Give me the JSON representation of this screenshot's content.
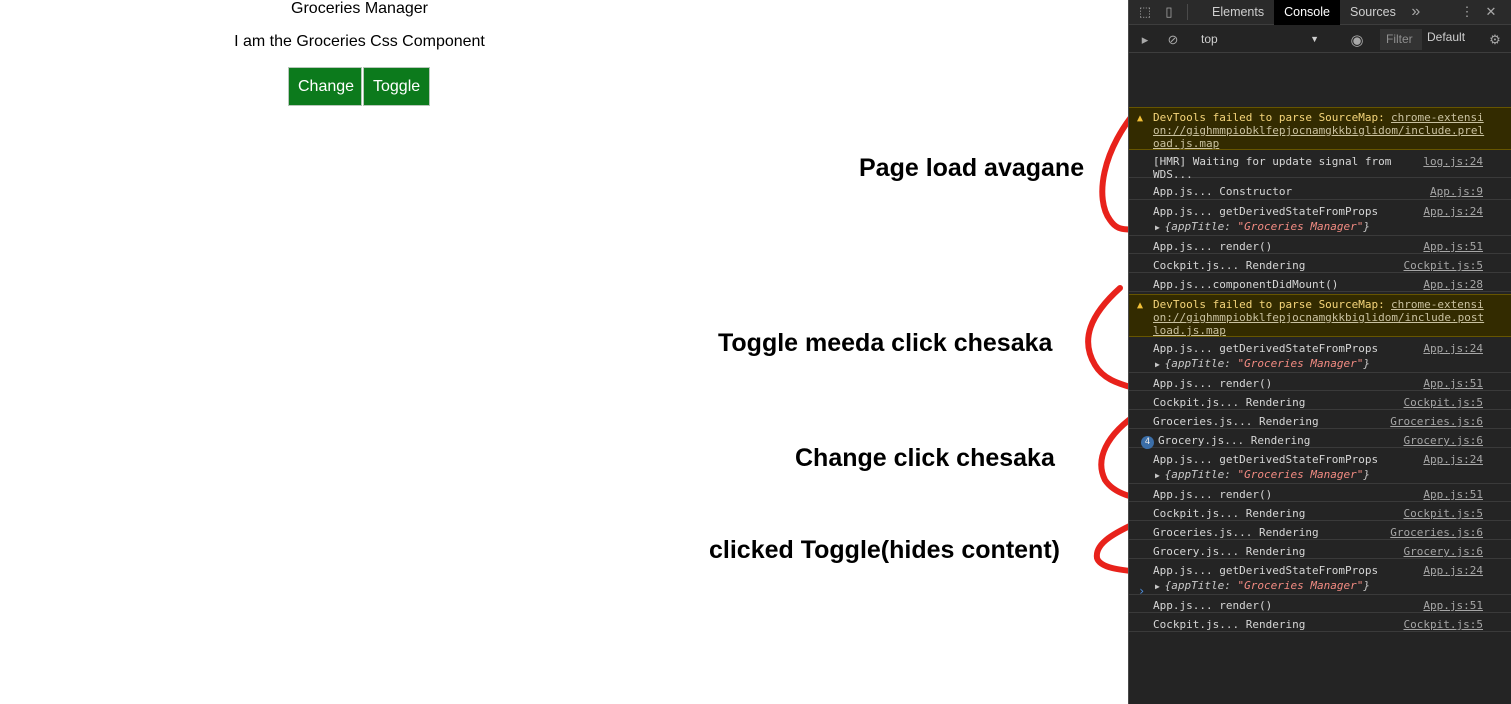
{
  "app": {
    "title": "Groceries Manager",
    "subtitle": "I am the Groceries Css Component",
    "buttons": {
      "change": "Change",
      "toggle": "Toggle"
    },
    "button_color": "#0c7a1c"
  },
  "annotations": {
    "page_load": "Page load avagane",
    "toggle_click": "Toggle meeda click chesaka",
    "change_click": "Change click chesaka",
    "clicked_toggle": "clicked Toggle(hides content)",
    "arc_color": "#e8221b"
  },
  "devtools": {
    "tabs": [
      "Elements",
      "Console",
      "Sources"
    ],
    "more_tabs": "»",
    "context": "top",
    "filter_placeholder": "Filter",
    "levels": "Default",
    "console": [
      {
        "type": "warn",
        "text": "DevTools failed to parse SourceMap: ",
        "link": "chrome-extensi\non://gighmmpiobklfepjocnamgkkbiglidom/include.prel\noad.js.map"
      },
      {
        "type": "log",
        "text": "[HMR] Waiting for update signal from\nWDS...",
        "src": "log.js:24"
      },
      {
        "type": "log",
        "text": "App.js... Constructor",
        "src": "App.js:9"
      },
      {
        "type": "log",
        "text": "App.js... getDerivedStateFromProps",
        "src": "App.js:24",
        "obj_key": "{appTitle: ",
        "obj_val": "\"Groceries Manager\"",
        "obj_end": "}"
      },
      {
        "type": "log",
        "text": "App.js... render()",
        "src": "App.js:51"
      },
      {
        "type": "log",
        "text": "Cockpit.js... Rendering",
        "src": "Cockpit.js:5"
      },
      {
        "type": "log",
        "text": "App.js...componentDidMount()",
        "src": "App.js:28"
      },
      {
        "type": "warn",
        "text": "DevTools failed to parse SourceMap: ",
        "link": "chrome-extensi\non://gighmmpiobklfepjocnamgkkbiglidom/include.post\nload.js.map"
      },
      {
        "type": "log",
        "text": "App.js... getDerivedStateFromProps",
        "src": "App.js:24",
        "obj_key": "{appTitle: ",
        "obj_val": "\"Groceries Manager\"",
        "obj_end": "}"
      },
      {
        "type": "log",
        "text": "App.js... render()",
        "src": "App.js:51"
      },
      {
        "type": "log",
        "text": "Cockpit.js... Rendering",
        "src": "Cockpit.js:5"
      },
      {
        "type": "log",
        "text": "Groceries.js... Rendering",
        "src": "Groceries.js:6"
      },
      {
        "type": "log",
        "text": "Grocery.js... Rendering",
        "src": "Grocery.js:6",
        "count": "4"
      },
      {
        "type": "log",
        "text": "App.js... getDerivedStateFromProps",
        "src": "App.js:24",
        "obj_key": "{appTitle: ",
        "obj_val": "\"Groceries Manager\"",
        "obj_end": "}"
      },
      {
        "type": "log",
        "text": "App.js... render()",
        "src": "App.js:51"
      },
      {
        "type": "log",
        "text": "Cockpit.js... Rendering",
        "src": "Cockpit.js:5"
      },
      {
        "type": "log",
        "text": "Groceries.js... Rendering",
        "src": "Groceries.js:6"
      },
      {
        "type": "log",
        "text": "Grocery.js... Rendering",
        "src": "Grocery.js:6"
      },
      {
        "type": "log",
        "text": "App.js... getDerivedStateFromProps",
        "src": "App.js:24",
        "obj_key": "{appTitle: ",
        "obj_val": "\"Groceries Manager\"",
        "obj_end": "}"
      },
      {
        "type": "log",
        "text": "App.js... render()",
        "src": "App.js:51"
      },
      {
        "type": "log",
        "text": "Cockpit.js... Rendering",
        "src": "Cockpit.js:5"
      }
    ],
    "prompt": "›"
  }
}
